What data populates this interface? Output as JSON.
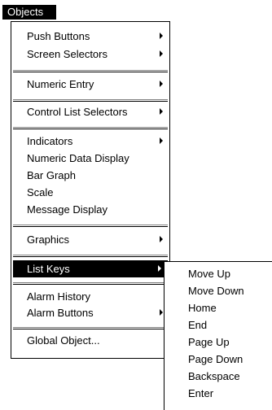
{
  "menubar": {
    "label": "Objects"
  },
  "menu": {
    "items": [
      {
        "label": "Push Buttons",
        "submenu": true
      },
      {
        "label": "Screen Selectors",
        "submenu": true
      },
      {
        "label": "Numeric Entry",
        "submenu": true
      },
      {
        "label": "Control List Selectors",
        "submenu": true
      },
      {
        "label": "Indicators",
        "submenu": true
      },
      {
        "label": "Numeric Data Display",
        "submenu": false
      },
      {
        "label": "Bar Graph",
        "submenu": false
      },
      {
        "label": "Scale",
        "submenu": false
      },
      {
        "label": "Message Display",
        "submenu": false
      },
      {
        "label": "Graphics",
        "submenu": true
      },
      {
        "label": "List Keys",
        "submenu": true,
        "selected": true
      },
      {
        "label": "Alarm History",
        "submenu": false
      },
      {
        "label": "Alarm Buttons",
        "submenu": true
      },
      {
        "label": "Global Object...",
        "submenu": false
      }
    ]
  },
  "submenu": {
    "items": [
      {
        "label": "Move Up"
      },
      {
        "label": "Move Down"
      },
      {
        "label": "Home"
      },
      {
        "label": "End"
      },
      {
        "label": "Page Up"
      },
      {
        "label": "Page Down"
      },
      {
        "label": "Backspace"
      },
      {
        "label": "Enter"
      }
    ]
  },
  "icons": {
    "submenu_indicator": "chevron-right-icon"
  }
}
